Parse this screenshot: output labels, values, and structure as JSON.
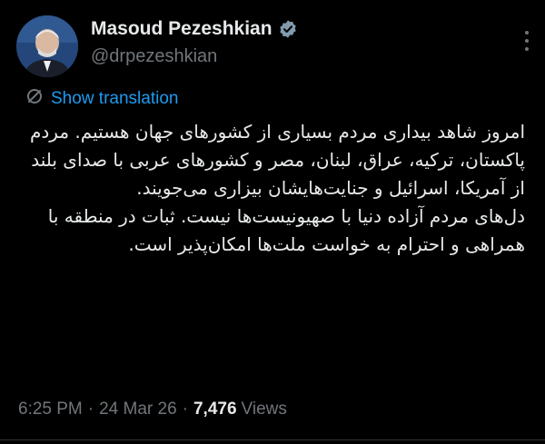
{
  "author": {
    "name": "Masoud Pezeshkian",
    "handle": "@drpezeshkian",
    "verified": true
  },
  "translate_label": "Show translation",
  "tweet": {
    "paragraphs": [
      "امروز شاهد بیداری مردم بسیاری از کشورهای جهان هستیم. مردم پاکستان، ترکیه، عراق، لبنان، مصر و کشورهای عربی با صدای بلند از آمریکا، اسرائیل و جنایت‌هایشان بیزاری می‌جویند.",
      "دل‌های مردم آزاده دنیا با صهیونیست‌ها نیست. ثبات در منطقه با همراهی و احترام به خواست ملت‌ها امکان‌پذیر است."
    ]
  },
  "meta": {
    "time": "6:25 PM",
    "date": "24 Mar 26",
    "separator": "·",
    "views_count": "7,476",
    "views_label": "Views"
  },
  "colors": {
    "background": "#000000",
    "text": "#e7e9ea",
    "muted": "#71767b",
    "link": "#1d9bf0",
    "badge": "#829aab"
  },
  "icons": {
    "badge": "verified-badge-icon",
    "translate": "translate-icon",
    "more": "more-options-icon"
  }
}
